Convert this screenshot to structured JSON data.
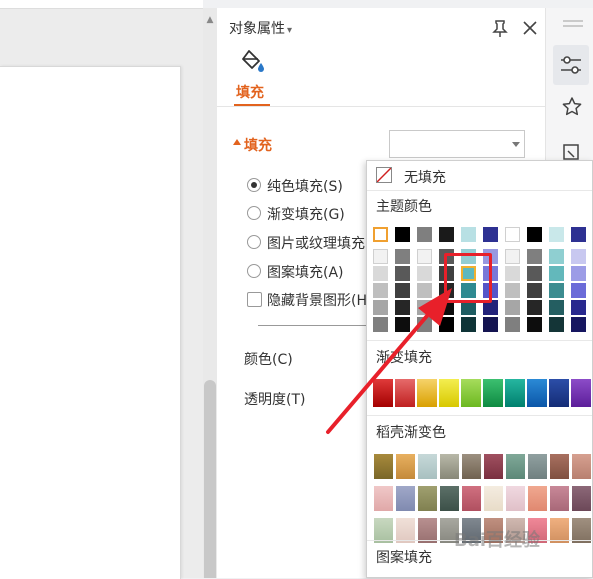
{
  "panel": {
    "title": "对象属性",
    "title_caret": "▾",
    "tab_fill": "填充",
    "section_title": "填充"
  },
  "fill_options": [
    {
      "label": "纯色填充(S)",
      "selected": true
    },
    {
      "label": "渐变填充(G)",
      "selected": false
    },
    {
      "label": "图片或纹理填充",
      "selected": false
    },
    {
      "label": "图案填充(A)",
      "selected": false
    }
  ],
  "hide_background": {
    "label": "隐藏背景图形(H",
    "checked": false
  },
  "props": {
    "color_label": "颜色(C)",
    "opacity_label": "透明度(T)"
  },
  "dropdown": {
    "no_fill_label": "无填充",
    "theme_colors_label": "主题颜色",
    "gradient_label": "渐变填充",
    "shell_gradient_label": "稻壳渐变色",
    "pattern_label": "图案填充",
    "selected_swatch": {
      "col": 4,
      "row": 2
    },
    "theme_colors": [
      [
        "#ffffff",
        "#000000",
        "#7f7f7f",
        "#1a1a1a",
        "#b8e0e4",
        "#2e3192",
        "#ffffff",
        "#000000",
        "#c9e8ea",
        "#2e3192"
      ],
      [
        "#f2f2f2",
        "#7f7f7f",
        "#f2f2f2",
        "#595959",
        "#93cdd3",
        "#9898e0",
        "#f2f2f2",
        "#7f7f7f",
        "#8fcfd1",
        "#c8c8f0"
      ],
      [
        "#d9d9d9",
        "#595959",
        "#d9d9d9",
        "#404040",
        "#5db8bf",
        "#7878d8",
        "#d9d9d9",
        "#595959",
        "#63b8bb",
        "#9c9ce6"
      ],
      [
        "#bfbfbf",
        "#404040",
        "#bfbfbf",
        "#262626",
        "#2e8a91",
        "#5555c9",
        "#bfbfbf",
        "#404040",
        "#3c8c90",
        "#6b6bd8"
      ],
      [
        "#a6a6a6",
        "#262626",
        "#a6a6a6",
        "#0d0d0d",
        "#1d5c61",
        "#22227a",
        "#a6a6a6",
        "#262626",
        "#245e61",
        "#28288e"
      ],
      [
        "#7f7f7f",
        "#0d0d0d",
        "#7f7f7f",
        "#000000",
        "#0f3437",
        "#141451",
        "#7f7f7f",
        "#0d0d0d",
        "#143537",
        "#161660"
      ]
    ],
    "gradient_colors": [
      [
        "#e03a3a",
        "#a40000"
      ],
      [
        "#e66a6a",
        "#c02020"
      ],
      [
        "#f6d36a",
        "#d9a000"
      ],
      [
        "#f4ee50",
        "#d8c800"
      ],
      [
        "#a6dc5c",
        "#6cb820"
      ],
      [
        "#3cc070",
        "#0e8a42"
      ],
      [
        "#26b6a0",
        "#00806e"
      ],
      [
        "#2b8ad6",
        "#0b56a8"
      ],
      [
        "#2c4ea8",
        "#142c76"
      ],
      [
        "#8c4cc8",
        "#5c1e9a"
      ]
    ],
    "shell_colors": [
      [
        "#a88a3c",
        "#7a6728"
      ],
      [
        "#e8b060",
        "#c48a3a"
      ],
      [
        "#c6d8d8",
        "#a8c0c0"
      ],
      [
        "#b8b8a8",
        "#888878"
      ],
      [
        "#9c9080",
        "#706250"
      ],
      [
        "#a05060",
        "#7a3040"
      ],
      [
        "#80a898",
        "#5c8878"
      ],
      [
        "#90a0a0",
        "#708080"
      ],
      [
        "#a87060",
        "#805040"
      ],
      [
        "#d6a090",
        "#b88070"
      ],
      [
        "#f0c8c8",
        "#e0a8a8"
      ],
      [
        "#a0a8c8",
        "#808ab0"
      ],
      [
        "#a0a070",
        "#808050"
      ],
      [
        "#5c7068",
        "#3c5048"
      ],
      [
        "#d07080",
        "#b05060"
      ],
      [
        "#f4ece0",
        "#e8dcc8"
      ],
      [
        "#f0d8e0",
        "#e0c0c8"
      ],
      [
        "#f0a890",
        "#e08870"
      ],
      [
        "#c88898",
        "#a86878"
      ],
      [
        "#8c6878",
        "#6c4858"
      ],
      [
        "#c8d8c0",
        "#a8c0a0"
      ],
      [
        "#f0e0d8",
        "#e0c8c0"
      ],
      [
        "#b89090",
        "#987070"
      ],
      [
        "#a8a8a0",
        "#888880"
      ],
      [
        "#808890",
        "#606870"
      ],
      [
        "#c09080",
        "#a07060"
      ],
      [
        "#d0b8b0",
        "#b09890"
      ],
      [
        "#f08898",
        "#d06878"
      ],
      [
        "#f0b080",
        "#d09060"
      ],
      [
        "#a09080",
        "#807060"
      ]
    ]
  },
  "watermark": "Bai百经验"
}
